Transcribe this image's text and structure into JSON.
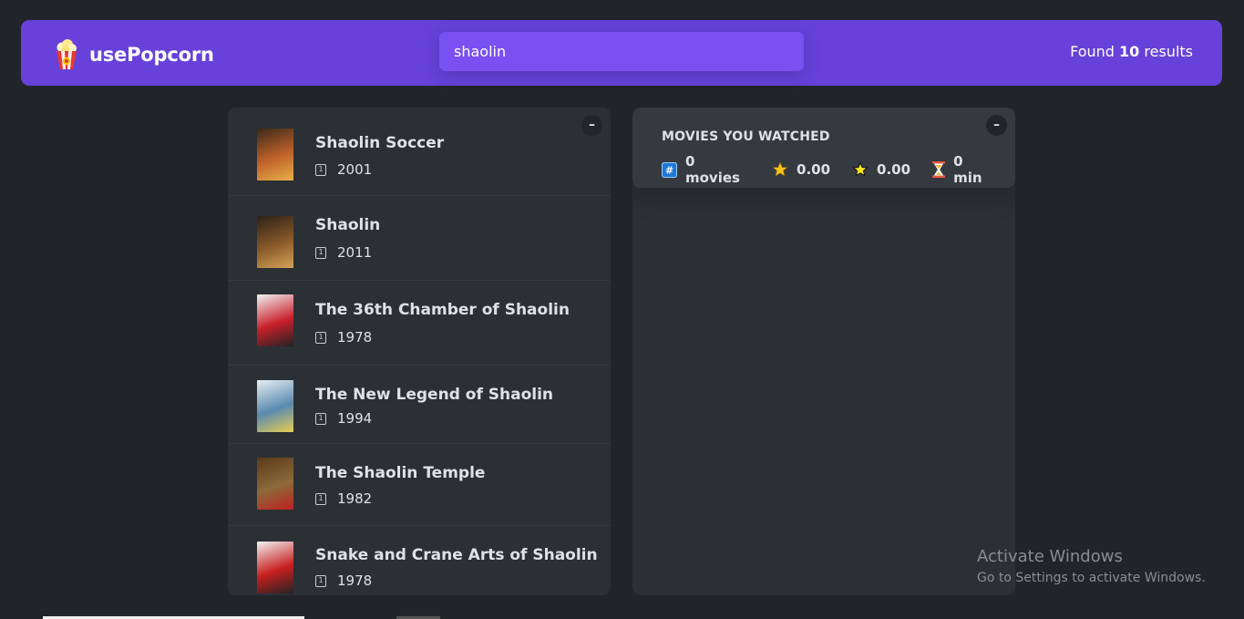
{
  "nav": {
    "logo_text": "usePopcorn",
    "search_value": "shaolin",
    "results_prefix": "Found ",
    "results_count": "10",
    "results_suffix": " results"
  },
  "list_panel": {
    "toggle_label": "–",
    "movies": [
      {
        "title": "Shaolin Soccer",
        "year": "2001",
        "poster_colors": [
          "#3a2a1a",
          "#c0622a",
          "#e8b04a"
        ]
      },
      {
        "title": "Shaolin",
        "year": "2011",
        "poster_colors": [
          "#2b2116",
          "#8a5a2a",
          "#d6a45a"
        ]
      },
      {
        "title": "The 36th Chamber of Shaolin",
        "year": "1978",
        "poster_colors": [
          "#f2f2f2",
          "#c8202a",
          "#222222"
        ]
      },
      {
        "title": "The New Legend of Shaolin",
        "year": "1994",
        "poster_colors": [
          "#e7eef3",
          "#5a8ab0",
          "#e8d050"
        ]
      },
      {
        "title": "The Shaolin Temple",
        "year": "1982",
        "poster_colors": [
          "#5a3a1a",
          "#8c6a3a",
          "#c02020"
        ]
      },
      {
        "title": "Snake and Crane Arts of Shaolin",
        "year": "1978",
        "poster_colors": [
          "#f2f2f2",
          "#c82020",
          "#222222"
        ]
      }
    ]
  },
  "watched_panel": {
    "toggle_label": "–",
    "heading": "MOVIES YOU WATCHED",
    "stats": {
      "movies": "0 movies",
      "imdb_rating": "0.00",
      "user_rating": "0.00",
      "runtime": "0 min"
    }
  },
  "watermark": {
    "title": "Activate Windows",
    "subtitle": "Go to Settings to activate Windows."
  },
  "colors": {
    "background": "#212529",
    "nav": "#6741d9",
    "search": "#7950f2",
    "panel": "#2b3035",
    "summary": "#343a40"
  }
}
